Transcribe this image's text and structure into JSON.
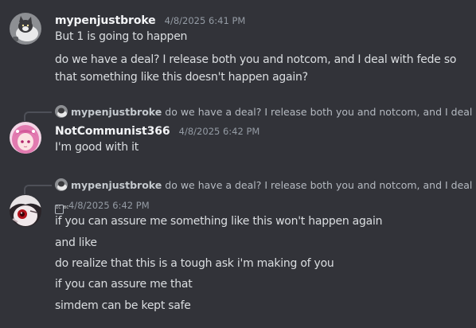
{
  "messages": [
    {
      "username": "mypenjustbroke",
      "timestamp": "4/8/2025 6:41 PM",
      "avatar_icon": "cat-avatar-icon",
      "lines": [
        "But 1 is going to happen",
        "do we have a deal? I release both you and notcom, and I deal with fede so",
        "that something like this doesn't happen again?"
      ]
    },
    {
      "reply_to": {
        "username": "mypenjustbroke",
        "text": "do we have a deal? I release both you and notcom, and I deal ..."
      },
      "username": "NotCommunist366",
      "timestamp": "4/8/2025 6:42 PM",
      "avatar_icon": "pink-hair-anime-avatar-icon",
      "lines": [
        "I'm good with it"
      ]
    },
    {
      "reply_to": {
        "username": "mypenjustbroke",
        "text": "do we have a deal? I release both you and notcom, and I deal ..."
      },
      "username": "",
      "tag_icon": "IC BC",
      "timestamp": "4/8/2025 6:42 PM",
      "avatar_icon": "red-eye-anime-avatar-icon",
      "lines": [
        "if you can assure me something like this won't happen again",
        "and like",
        "do realize that this is a tough ask i'm making of you",
        "if you can assure me that",
        "simdem can be kept safe"
      ]
    }
  ],
  "colors": {
    "background": "#323339",
    "username": "#f2f3f5",
    "message_text": "#dbdee1",
    "timestamp": "#949ba4"
  }
}
